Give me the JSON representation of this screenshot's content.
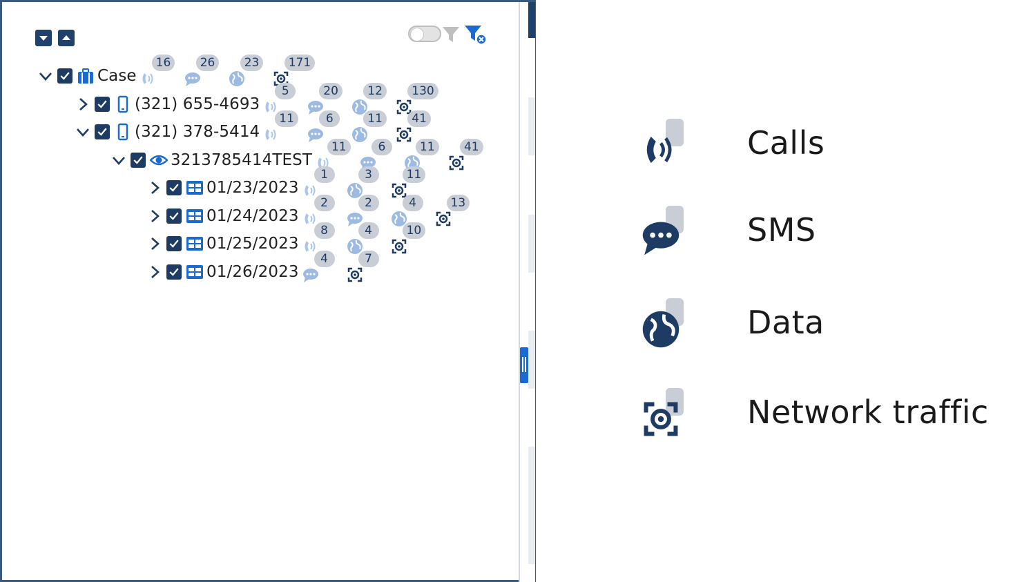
{
  "colors": {
    "navy": "#1d3b63",
    "blue": "#1a6ad0",
    "badge_bg": "#c9cdd5",
    "icon_light": "#a9c7ec"
  },
  "toolbar": {
    "expand_all_icon": "caret-down-square-icon",
    "collapse_all_icon": "caret-up-square-icon",
    "filter_toggle_state": "off",
    "filter_icon": "funnel-icon",
    "clear_filter_icon": "funnel-clear-icon"
  },
  "tree": {
    "rows": [
      {
        "label": "Case",
        "expanded": true,
        "icon": "briefcase-icon",
        "metrics": {
          "calls": "16",
          "sms": "26",
          "data": "23",
          "network": "171"
        }
      },
      {
        "label": "(321) 655-4693",
        "expanded": false,
        "icon": "phone-icon",
        "metrics": {
          "calls": "5",
          "sms": "20",
          "data": "12",
          "network": "130"
        }
      },
      {
        "label": "(321) 378-5414",
        "expanded": true,
        "icon": "phone-icon",
        "metrics": {
          "calls": "11",
          "sms": "6",
          "data": "11",
          "network": "41"
        }
      },
      {
        "label": "3213785414TEST",
        "expanded": true,
        "icon": "eye-icon",
        "metrics": {
          "calls": "11",
          "sms": "6",
          "data": "11",
          "network": "41"
        }
      },
      {
        "label": "01/23/2023",
        "expanded": false,
        "icon": "calendar-grid-icon",
        "metrics": {
          "calls": "1",
          "data": "3",
          "network": "11"
        }
      },
      {
        "label": "01/24/2023",
        "expanded": false,
        "icon": "calendar-grid-icon",
        "metrics": {
          "calls": "2",
          "sms": "2",
          "data": "4",
          "network": "13"
        }
      },
      {
        "label": "01/25/2023",
        "expanded": false,
        "icon": "calendar-grid-icon",
        "metrics": {
          "calls": "8",
          "data": "4",
          "network": "10"
        }
      },
      {
        "label": "01/26/2023",
        "expanded": false,
        "icon": "calendar-grid-icon",
        "metrics": {
          "sms": "4",
          "network": "7"
        }
      }
    ]
  },
  "legend": {
    "items": [
      {
        "label": "Calls",
        "icon": "calls-icon"
      },
      {
        "label": "SMS",
        "icon": "sms-icon"
      },
      {
        "label": "Data",
        "icon": "data-globe-icon"
      },
      {
        "label": "Network traffic",
        "icon": "network-traffic-icon"
      }
    ]
  }
}
